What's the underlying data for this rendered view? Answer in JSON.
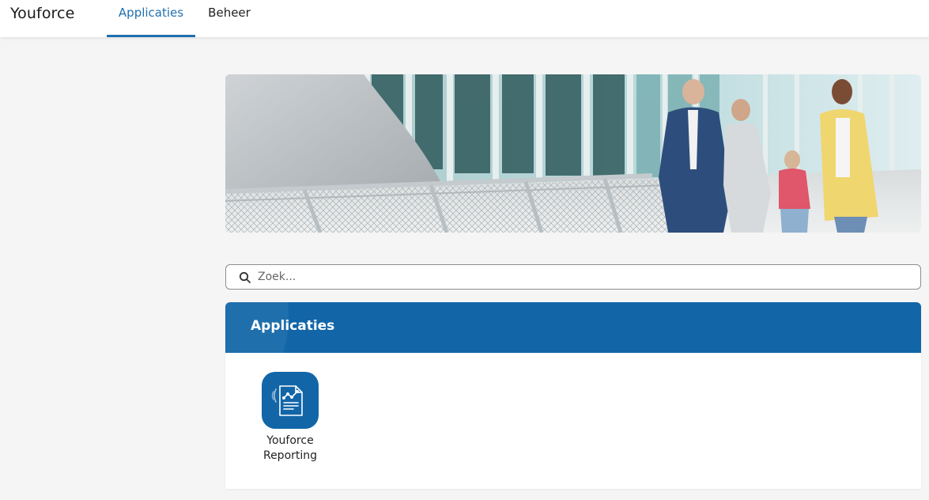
{
  "header": {
    "brand": "Youforce",
    "tabs": [
      {
        "label": "Applicaties",
        "active": true
      },
      {
        "label": "Beheer",
        "active": false
      }
    ]
  },
  "hero": {
    "image": "photo of business people walking on a walkway in a glass building"
  },
  "search": {
    "placeholder": "Zoek...",
    "value": "",
    "icon": "search-icon"
  },
  "apps_panel": {
    "title": "Applicaties",
    "apps": [
      {
        "label_line1": "Youforce",
        "label_line2": "Reporting",
        "icon": "report-document-icon"
      }
    ]
  },
  "colors": {
    "accent": "#1f6fae",
    "panel_header": "#1266a8",
    "background": "#f5f5f5"
  }
}
